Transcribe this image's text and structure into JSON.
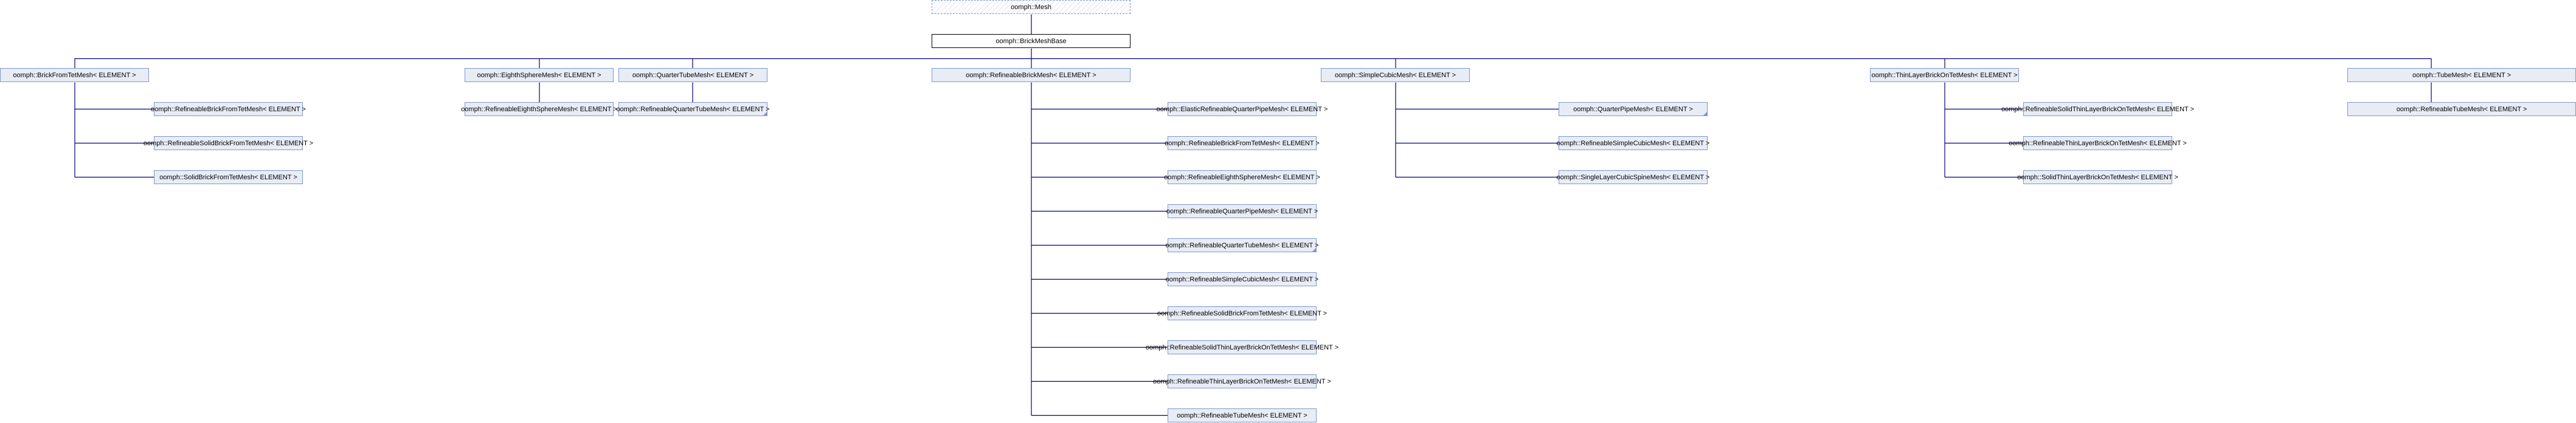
{
  "colors": {
    "edge": "#000080",
    "node_fill": "#e8ecf5",
    "node_border": "#7f97cc"
  },
  "root": "oomph::Mesh",
  "base": "oomph::BrickMeshBase",
  "level1": {
    "brick_from_tet": "oomph::BrickFromTetMesh< ELEMENT >",
    "eighth_sphere": "oomph::EighthSphereMesh< ELEMENT >",
    "quarter_tube": "oomph::QuarterTubeMesh< ELEMENT >",
    "refineable_brick": "oomph::RefineableBrickMesh< ELEMENT >",
    "simple_cubic": "oomph::SimpleCubicMesh< ELEMENT >",
    "thin_layer": "oomph::ThinLayerBrickOnTetMesh< ELEMENT >",
    "tube": "oomph::TubeMesh< ELEMENT >"
  },
  "brick_from_tet_children": [
    "oomph::RefineableBrickFromTetMesh< ELEMENT >",
    "oomph::RefineableSolidBrickFromTetMesh< ELEMENT >",
    "oomph::SolidBrickFromTetMesh< ELEMENT >"
  ],
  "eighth_sphere_children": [
    "oomph::RefineableEighthSphereMesh< ELEMENT >"
  ],
  "quarter_tube_children": [
    "oomph::RefineableQuarterTubeMesh< ELEMENT >"
  ],
  "refineable_brick_children": [
    "oomph::ElasticRefineableQuarterPipeMesh< ELEMENT >",
    "oomph::RefineableBrickFromTetMesh< ELEMENT >",
    "oomph::RefineableEighthSphereMesh< ELEMENT >",
    "oomph::RefineableQuarterPipeMesh< ELEMENT >",
    "oomph::RefineableQuarterTubeMesh< ELEMENT >",
    "oomph::RefineableSimpleCubicMesh< ELEMENT >",
    "oomph::RefineableSolidBrickFromTetMesh< ELEMENT >",
    "oomph::RefineableSolidThinLayerBrickOnTetMesh< ELEMENT >",
    "oomph::RefineableThinLayerBrickOnTetMesh< ELEMENT >",
    "oomph::RefineableTubeMesh< ELEMENT >"
  ],
  "simple_cubic_children": [
    "oomph::QuarterPipeMesh< ELEMENT >",
    "oomph::RefineableSimpleCubicMesh< ELEMENT >",
    "oomph::SingleLayerCubicSpineMesh< ELEMENT >"
  ],
  "thin_layer_children": [
    "oomph::RefineableSolidThinLayerBrickOnTetMesh< ELEMENT >",
    "oomph::RefineableThinLayerBrickOnTetMesh< ELEMENT >",
    "oomph::SolidThinLayerBrickOnTetMesh< ELEMENT >"
  ],
  "tube_children": [
    "oomph::RefineableTubeMesh< ELEMENT >"
  ]
}
